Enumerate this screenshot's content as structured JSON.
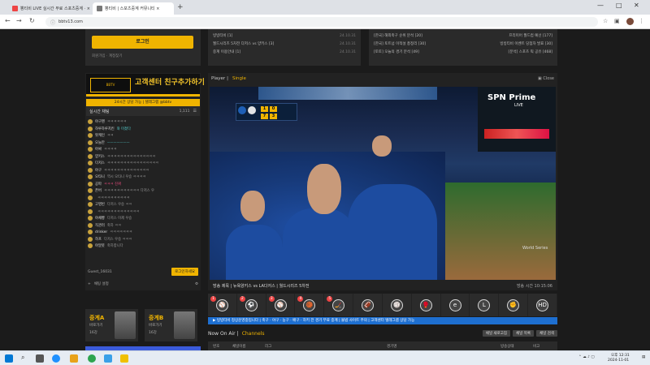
{
  "browser": {
    "tabs": [
      {
        "label": "뽕티비 LIVE 실시간 무료 스포츠중계 · ×",
        "active": false
      },
      {
        "label": "뽕티비 | 스포츠중계 커뮤니티 ×",
        "active": true
      }
    ],
    "new_tab": "+",
    "url": "bbtv13.com",
    "window_controls": [
      "—",
      "□",
      "✕"
    ]
  },
  "login": {
    "button": "로그인",
    "links": "회원가입 · 계정찾기"
  },
  "news_left": [
    {
      "title": "빙빙티비 [1]",
      "date": "24.10.31"
    },
    {
      "title": "월드시리즈 5차전 다저스 vs 양키스 [3]",
      "date": "24.10.31"
    },
    {
      "title": "중계 이용안내 [1]",
      "date": "24.10.31"
    }
  ],
  "news_right": [
    {
      "title": "[한국] 해외축구 순위 분석 [20]",
      "title2": "프리미어 월드컵 예선 [177]"
    },
    {
      "title": "[한국] 토트넘 이적설 총정리 [30]",
      "title2": "빙빙티비 이벤트 당첨자 발표 [30]"
    },
    {
      "title": "[토토] 오늘의 경기 분석 [49]",
      "title2": "[분석] 스포츠 픽 공유 [468]"
    }
  ],
  "side": {
    "banner_logo": "BBTV",
    "banner_text": "고객센터 친구추가하기",
    "banner_sub": "24시간 상담 가능 | 텔레그램 @bbtv",
    "chat_title": "실시간 채팅",
    "chat_count": "1,111",
    "chat": [
      {
        "name": "야구팬",
        "msg": "ㅋㅋㅋㅋㅋㅋ",
        "style": ""
      },
      {
        "name": "하루하루치킨",
        "msg": "와 미쳤다",
        "style": "cyan"
      },
      {
        "name": "팟캐인",
        "msg": "ㅋㅋ",
        "style": ""
      },
      {
        "name": "오늘만",
        "msg": "ㅡㅡㅡㅡㅡㅡㅡ",
        "style": "cyan"
      },
      {
        "name": "아싸",
        "msg": "ㅋㅋㅋㅋ",
        "style": ""
      },
      {
        "name": "양키스",
        "msg": "ㅋㅋㅋㅋㅋㅋㅋㅋㅋㅋㅋㅋㅋㅋㅋ",
        "style": ""
      },
      {
        "name": "다저스",
        "msg": "ㅋㅋㅋㅋㅋㅋㅋㅋㅋㅋㅋㅋㅋㅋㅋㅋ",
        "style": ""
      },
      {
        "name": "야구",
        "msg": "ㅋㅋㅋㅋㅋㅋㅋㅋㅋㅋㅋㅋㅋㅋ",
        "style": ""
      },
      {
        "name": "오타니",
        "msg": "역시 오타니 우승 ㅋㅋㅋㅋ",
        "style": ""
      },
      {
        "name": "공파",
        "msg": "ㅋㅋㅋ 진짜",
        "style": "pink"
      },
      {
        "name": "존버",
        "msg": "ㅋㅋㅋㅋㅋㅋㅋㅋㅋㅋㅋ 다저스 우",
        "style": ""
      },
      {
        "name": "",
        "msg": "ㅋㅋㅋㅋㅋㅋㅋㅋㅋㅋ",
        "style": ""
      },
      {
        "name": "고영빈",
        "msg": "다저스 우승 ㅋㅋ",
        "style": ""
      },
      {
        "name": "",
        "msg": "ㅋㅋㅋㅋㅋㅋㅋㅋㅋㅋㅋㅋㅋ",
        "style": ""
      },
      {
        "name": "야채빵",
        "msg": "다저스 이제 우승",
        "style": ""
      },
      {
        "name": "직관러",
        "msg": "축하 ㅋㅋ",
        "style": ""
      },
      {
        "name": "drinker",
        "msg": "ㅋㅋㅋㅋㅋㅋㅋ",
        "style": ""
      },
      {
        "name": "하프",
        "msg": "다저스 우승 ㅋㅋㅋ",
        "style": ""
      },
      {
        "name": "야알못",
        "msg": "축하합니다",
        "style": ""
      }
    ],
    "chat_user": "Guest_16031",
    "chat_send": "로그인하세요",
    "chat_footer": "채팅 설정"
  },
  "promos": [
    {
      "big": "중계A",
      "small": "바로가기",
      "tag": "16강"
    },
    {
      "big": "중계B",
      "small": "바로가기",
      "tag": "16강"
    }
  ],
  "player": {
    "title": "Player",
    "mode": "Single",
    "close": "Close",
    "scoreboard_brand": "SPN Prime",
    "scoreboard_live": "LIVE",
    "score_cells": [
      "1",
      "0",
      "7",
      "3"
    ],
    "watermark": "World Series",
    "info_title": "방송 제목 | 뉴욕양키스 vs LA다저스 | 월드시리즈 5차전",
    "info_time": "방송 시간  10:15:06"
  },
  "sports": [
    {
      "icon": "⚾",
      "badge": "1"
    },
    {
      "icon": "⚽",
      "badge": "2"
    },
    {
      "icon": "⚾",
      "badge": "3"
    },
    {
      "icon": "🏀",
      "badge": "4"
    },
    {
      "icon": "🏒",
      "badge": "5"
    },
    {
      "icon": "🏈",
      "badge": ""
    },
    {
      "icon": "🏐",
      "badge": ""
    },
    {
      "icon": "🥊",
      "badge": ""
    },
    {
      "icon": "e",
      "badge": ""
    },
    {
      "icon": "L",
      "badge": ""
    },
    {
      "icon": "✊",
      "badge": ""
    },
    {
      "icon": "HD",
      "badge": ""
    }
  ],
  "ticker": "▶ 빙빙티비 정상운영중입니다 | 축구 · 야구 · 농구 · 배구 · 하키 전 경기 무료 중계 | 불법 사이트 주의 | 고객센터 텔레그램 상담 가능",
  "now_air": {
    "title": "Now On Air",
    "sub": "Channels",
    "buttons": [
      "채널 새로고침",
      "채널 목록",
      "채널 검색"
    ]
  },
  "table_head": [
    "번호",
    "채널이름",
    "리그",
    "경기명",
    "방송상태",
    "비고"
  ],
  "taskbar": {
    "time": "오후 12:31",
    "date": "2024-11-01"
  }
}
